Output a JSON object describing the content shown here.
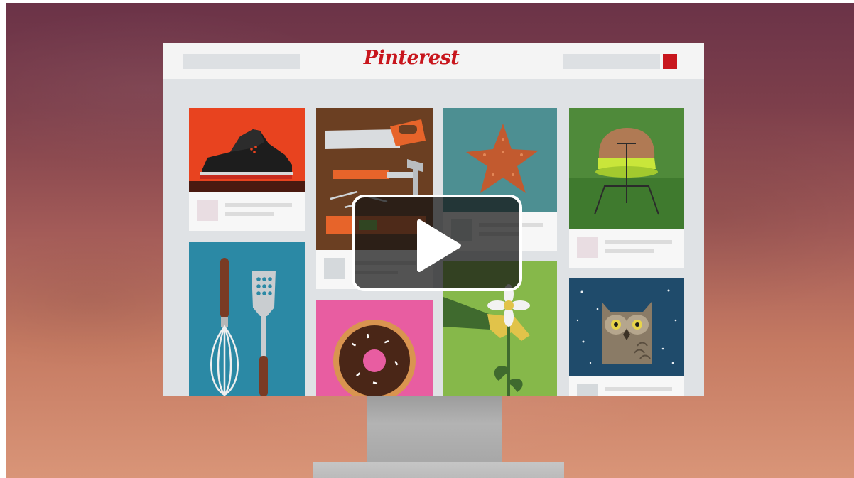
{
  "video": {
    "logo_text": "Pinterest",
    "play_icon": "play-icon",
    "colors": {
      "brand_red": "#c8161d",
      "background_top": "#6b3348",
      "background_bottom": "#d99578"
    },
    "pins": [
      {
        "name": "sneaker",
        "icon": "sneaker-icon"
      },
      {
        "name": "tools",
        "icon": "tools-icon"
      },
      {
        "name": "starfish",
        "icon": "starfish-icon"
      },
      {
        "name": "chair",
        "icon": "chair-icon"
      },
      {
        "name": "kitchen-utensils",
        "icon": "whisk-spatula-icon"
      },
      {
        "name": "donut",
        "icon": "donut-icon"
      },
      {
        "name": "flower",
        "icon": "flower-icon"
      },
      {
        "name": "owl",
        "icon": "owl-icon"
      }
    ]
  }
}
